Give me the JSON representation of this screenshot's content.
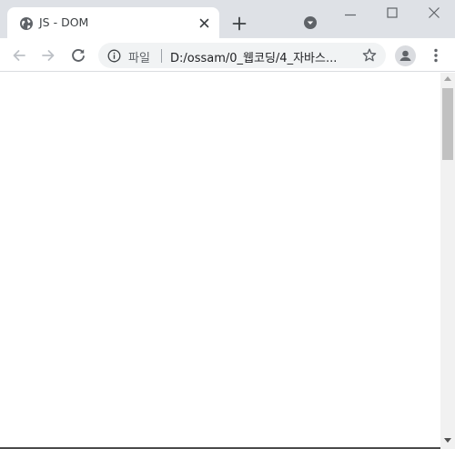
{
  "tab": {
    "title": "JS - DOM",
    "favicon": "globe-icon",
    "close_icon": "close-icon"
  },
  "tabstrip": {
    "new_tab_icon": "plus-icon",
    "tab_search_icon": "chevron-down-circle-icon"
  },
  "window_controls": {
    "minimize_icon": "minimize-icon",
    "maximize_icon": "maximize-icon",
    "close_icon": "close-icon"
  },
  "toolbar": {
    "back_icon": "back-arrow-icon",
    "forward_icon": "forward-arrow-icon",
    "reload_icon": "reload-icon",
    "omnibox": {
      "info_icon": "info-icon",
      "scheme_label": "파일",
      "url": "D:/ossam/0_웹코딩/4_자바스...",
      "bookmark_icon": "star-icon"
    },
    "profile_icon": "account-icon",
    "menu_icon": "more-vert-icon"
  },
  "colors": {
    "tabstrip_bg": "#dee1e6",
    "omnibox_bg": "#f1f3f4",
    "icon": "#5f6368",
    "text": "#3c4043"
  }
}
